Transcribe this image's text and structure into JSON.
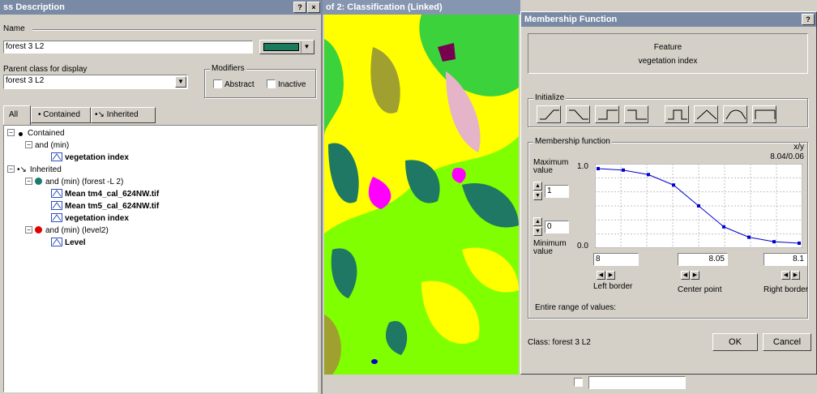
{
  "left_dialog": {
    "title": "ss Description",
    "help_btn": "?",
    "close_btn": "×",
    "name_label": "Name",
    "name_value": "forest 3 L2",
    "color_swatch": "#1a7a5c",
    "parent_label": "Parent class for display",
    "parent_value": "forest 3 L2",
    "modifiers_label": "Modifiers",
    "abstract_label": "Abstract",
    "inactive_label": "Inactive",
    "tabs": [
      "All",
      "Contained",
      "Inherited"
    ],
    "tree": [
      {
        "text": "Contained",
        "depth": 0,
        "exp": "−",
        "icon": "dot-black"
      },
      {
        "text": "and (min)",
        "depth": 1,
        "exp": "−",
        "icon": "none"
      },
      {
        "text": "vegetation index",
        "depth": 2,
        "exp": "",
        "icon": "fn",
        "bold": true
      },
      {
        "text": "Inherited",
        "depth": 0,
        "exp": "−",
        "icon": "inherit"
      },
      {
        "text": "and (min) (forest -L 2)",
        "depth": 1,
        "exp": "−",
        "icon": "dot-teal"
      },
      {
        "text": "Mean tm4_cal_624NW.tif",
        "depth": 2,
        "exp": "",
        "icon": "fn",
        "bold": true
      },
      {
        "text": "Mean tm5_cal_624NW.tif",
        "depth": 2,
        "exp": "",
        "icon": "fn",
        "bold": true
      },
      {
        "text": "vegetation index",
        "depth": 2,
        "exp": "",
        "icon": "fn",
        "bold": true
      },
      {
        "text": "and (min) (level2)",
        "depth": 1,
        "exp": "−",
        "icon": "dot-red"
      },
      {
        "text": "Level",
        "depth": 2,
        "exp": "",
        "icon": "fn",
        "bold": true
      }
    ]
  },
  "map_window": {
    "title": "of 2: Classification (Linked)",
    "colors": {
      "lime": "#7fff00",
      "yellow": "#ffff00",
      "green": "#3cd23c",
      "teal": "#1e7864",
      "olive": "#a0a030",
      "magenta": "#ff00ff",
      "pink": "#e6b4c8",
      "purple": "#780050",
      "blue": "#0000c8"
    }
  },
  "membership": {
    "title": "Membership Function",
    "help_btn": "?",
    "feature_label": "Feature",
    "feature_name": "vegetation index",
    "initialize_label": "Initialize",
    "function_label": "Membership function",
    "xy_label": "x/y",
    "xy_value": "8.04/0.06",
    "max_label": "Maximum value",
    "max_value": "1",
    "min_label": "Minimum value",
    "min_value": "0",
    "y_top": "1.0",
    "y_bottom": "0.0",
    "left_border_value": "8",
    "center_value": "8.05",
    "right_border_value": "8.1",
    "left_border_label": "Left border",
    "center_label": "Center point",
    "right_border_label": "Right border",
    "range_label": "Entire range of values:",
    "class_label": "Class: forest 3 L2",
    "ok_label": "OK",
    "cancel_label": "Cancel",
    "curve": {
      "x": [
        8.0,
        8.0125,
        8.025,
        8.0375,
        8.05,
        8.0625,
        8.075,
        8.0875,
        8.1
      ],
      "y": [
        1.0,
        0.98,
        0.92,
        0.78,
        0.5,
        0.22,
        0.08,
        0.02,
        0.0
      ]
    }
  }
}
